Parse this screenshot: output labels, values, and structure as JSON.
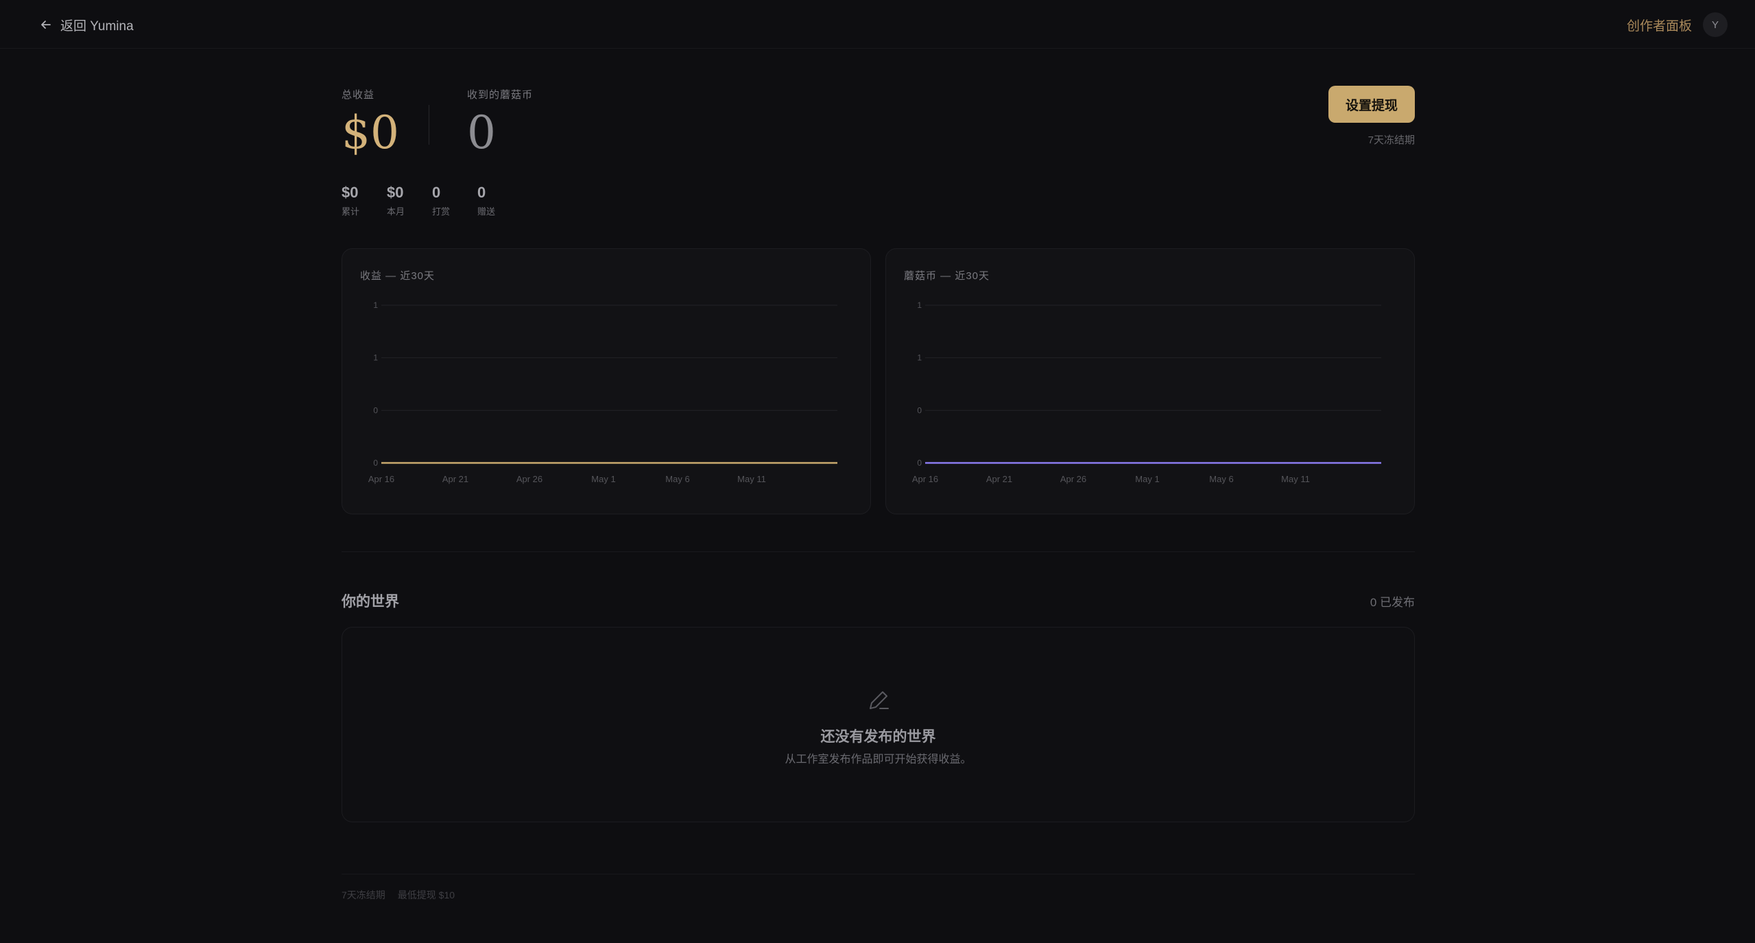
{
  "header": {
    "back_label": "返回 Yumina",
    "creator_panel": "创作者面板",
    "avatar_initial": "Y"
  },
  "stats": {
    "total_earnings_label": "总收益",
    "total_earnings": "$0",
    "coins_label": "收到的蘑菇币",
    "coins": "0",
    "withdraw_button": "设置提现",
    "freeze_note": "7天冻结期",
    "mini": [
      {
        "value": "$0",
        "label": "累计"
      },
      {
        "value": "$0",
        "label": "本月"
      },
      {
        "value": "0",
        "label": "打赏"
      },
      {
        "value": "0",
        "label": "赠送"
      }
    ]
  },
  "chart_data": [
    {
      "type": "line",
      "title": "收益 — 近30天",
      "x": [
        "Apr 16",
        "Apr 21",
        "Apr 26",
        "May 1",
        "May 6",
        "May 11"
      ],
      "y_ticks": [
        "1",
        "1",
        "0",
        "0"
      ],
      "ylim": [
        0,
        1
      ],
      "grid": true,
      "series": [
        {
          "values": [
            0,
            0,
            0,
            0,
            0,
            0,
            0
          ],
          "color": "#c9a96e"
        }
      ]
    },
    {
      "type": "line",
      "title": "蘑菇币 — 近30天",
      "x": [
        "Apr 16",
        "Apr 21",
        "Apr 26",
        "May 1",
        "May 6",
        "May 11"
      ],
      "y_ticks": [
        "1",
        "1",
        "0",
        "0"
      ],
      "ylim": [
        0,
        1
      ],
      "grid": true,
      "series": [
        {
          "values": [
            0,
            0,
            0,
            0,
            0,
            0,
            0
          ],
          "color": "#8b7bf0"
        }
      ]
    }
  ],
  "worlds": {
    "title": "你的世界",
    "published_count": "0 已发布",
    "empty_title": "还没有发布的世界",
    "empty_subtitle": "从工作室发布作品即可开始获得收益。",
    "empty_icon": "pencil-icon"
  },
  "footer": {
    "freeze": "7天冻结期",
    "min_withdraw": "最低提现 $10"
  }
}
